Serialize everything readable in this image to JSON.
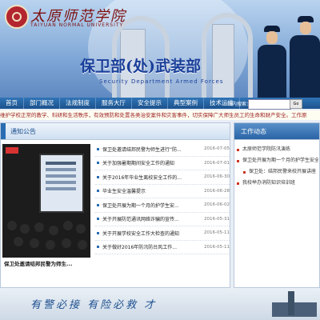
{
  "header": {
    "school_name": "太原师范学院",
    "school_name_en": "TAIYUAN NORMAL UNIVERSITY",
    "dept_title": "保卫部(处)武装部",
    "dept_en": "Security Department  Armed Forces"
  },
  "nav": {
    "items": [
      "首页",
      "部门概况",
      "法规制度",
      "服务大厅",
      "安全提示",
      "典型案例",
      "技术运维"
    ],
    "search_label": "站内搜索：",
    "search_placeholder": "",
    "search_button": "Go"
  },
  "marquee": "维护学校正常的教学、科研和生活秩序，有效预防和处置各类治安案件和灾害事件，切实保障广大师生员工的生命和财产安全。工作原",
  "notice": {
    "title": "通知公告",
    "photo_caption": "保卫处邀请结邦民警为师生...",
    "items": [
      {
        "title": "保卫处邀请结邦民警为师生进行“防...",
        "date": "2016-07-05"
      },
      {
        "title": "关于加强暑期期间安全工作的通知",
        "date": "2016-07-01"
      },
      {
        "title": "关于2016年毕业生离校安全工作的...",
        "date": "2016-06-30"
      },
      {
        "title": "毕业生安全温馨提示",
        "date": "2016-06-28"
      },
      {
        "title": "保卫处开展为期一个月的护学生安...",
        "date": "2016-06-02"
      },
      {
        "title": "关于开展防范通讯网络诈骗的宣传...",
        "date": "2016-05-31"
      },
      {
        "title": "关于开展学校安全工作大检查的通知",
        "date": "2016-05-11"
      },
      {
        "title": "关于做好2016年防汛防台风工作...",
        "date": "2016-05-11"
      }
    ]
  },
  "work": {
    "title": "工作动态",
    "items": [
      {
        "text": "太原师范学院防汛演练",
        "indent": false
      },
      {
        "text": "保卫处开展为期一个月的护学生安全...",
        "indent": false
      },
      {
        "text": "保卫处：结邦民警来校开展讲座",
        "indent": true
      },
      {
        "text": "我校举办消防知识培训班",
        "indent": false
      }
    ]
  },
  "footer": {
    "slogan": "有警必接  有险必救  才"
  },
  "colors": {
    "nav_bg": "#1c528c",
    "accent": "#2a6cb1",
    "marquee_text": "#9b1e1e"
  }
}
